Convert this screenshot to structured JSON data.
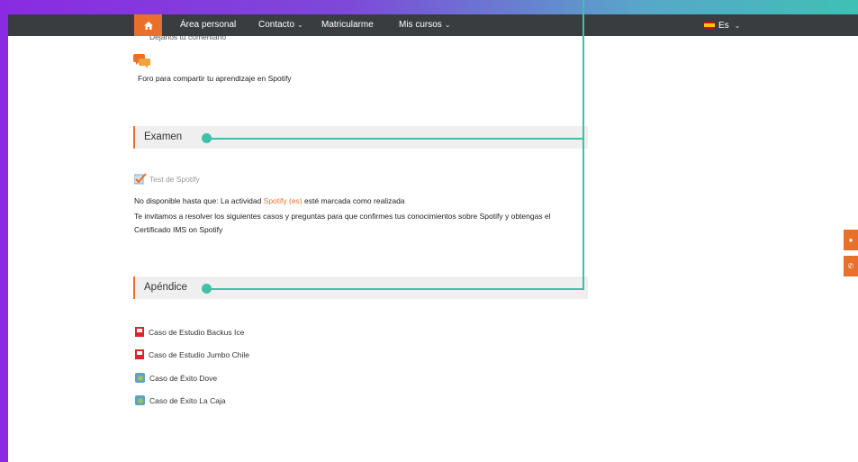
{
  "nav": {
    "items": [
      {
        "label": "Área personal"
      },
      {
        "label": "Contacto"
      },
      {
        "label": "Matricularme"
      },
      {
        "label": "Mis cursos"
      }
    ],
    "chevron": "⌄",
    "language": "Es"
  },
  "forum": {
    "partial_text": "Déjanos tu comentario",
    "text": "Foro para compartir tu aprendizaje en Spotify"
  },
  "sections": {
    "exam": {
      "title": "Examen",
      "quiz_label": "Test de Spotify",
      "availability_prefix": "No disponible hasta que: La actividad ",
      "availability_link": "Spotify (es)",
      "availability_suffix": " esté marcada como realizada",
      "description": "Te invitamos a resolver los siguientes casos y preguntas para que confirmes tus conocimientos sobre Spotify y obtengas el Certificado IMS on Spotify"
    },
    "appendix": {
      "title": "Apéndice",
      "resources": [
        {
          "label": "Caso de Estudio Backus Ice",
          "icon": "pdf-icon"
        },
        {
          "label": "Caso de Estudio Jumbo Chile",
          "icon": "pdf-icon"
        },
        {
          "label": "Caso de Éxito Dove",
          "icon": "web-page-icon"
        },
        {
          "label": "Caso de Éxito La Caja",
          "icon": "web-page-icon"
        }
      ]
    }
  },
  "colors": {
    "accent": "#e8702a",
    "annotation": "#3ec1a8",
    "frame": "#8a2be2",
    "navbar": "#3a3d40"
  }
}
